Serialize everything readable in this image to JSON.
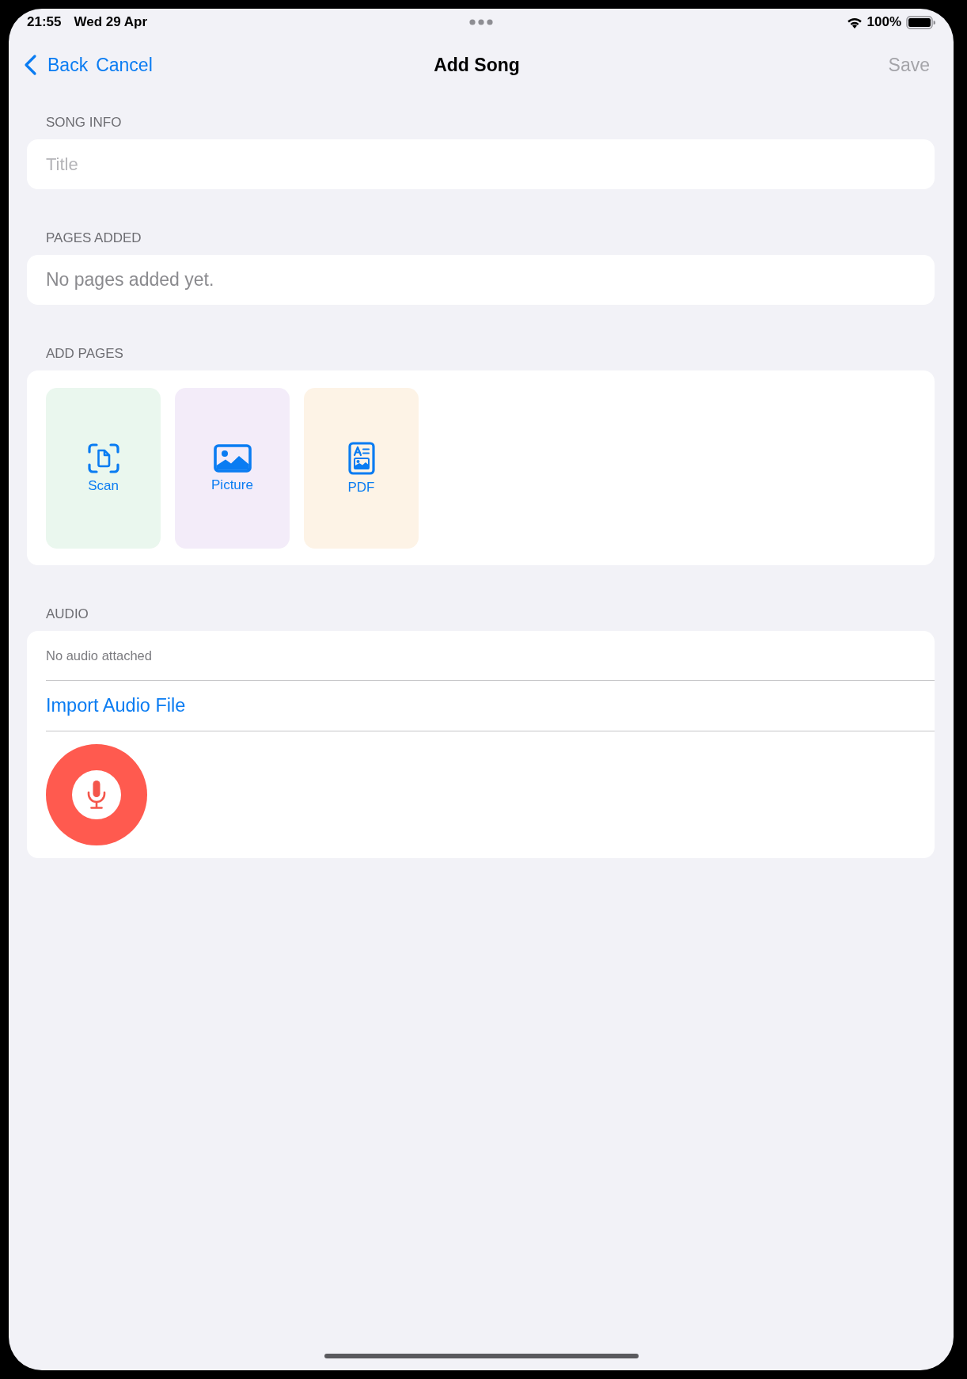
{
  "status_bar": {
    "time": "21:55",
    "date": "Wed 29 Apr",
    "battery": "100%"
  },
  "nav_bar": {
    "back": "Back",
    "cancel": "Cancel",
    "title": "Add Song",
    "save": {
      "label": "Save",
      "disabled": true
    }
  },
  "song_info": {
    "header": "SONG INFO",
    "title_field": {
      "placeholder": "Title"
    }
  },
  "pages_added": {
    "header": "PAGES ADDED",
    "message": "No pages added yet."
  },
  "add_pages": {
    "header": "ADD PAGES",
    "sources": [
      {
        "kind": "scan",
        "label": "Scan",
        "color": "#eaf7ee"
      },
      {
        "kind": "picture",
        "label": "Picture",
        "color": "#f3ecf9"
      },
      {
        "kind": "pdf",
        "label": "PDF",
        "color": "#fdf3e6"
      }
    ]
  },
  "audio": {
    "header": "AUDIO",
    "status": "No audio attached",
    "import_link": "Import Audio File"
  }
}
